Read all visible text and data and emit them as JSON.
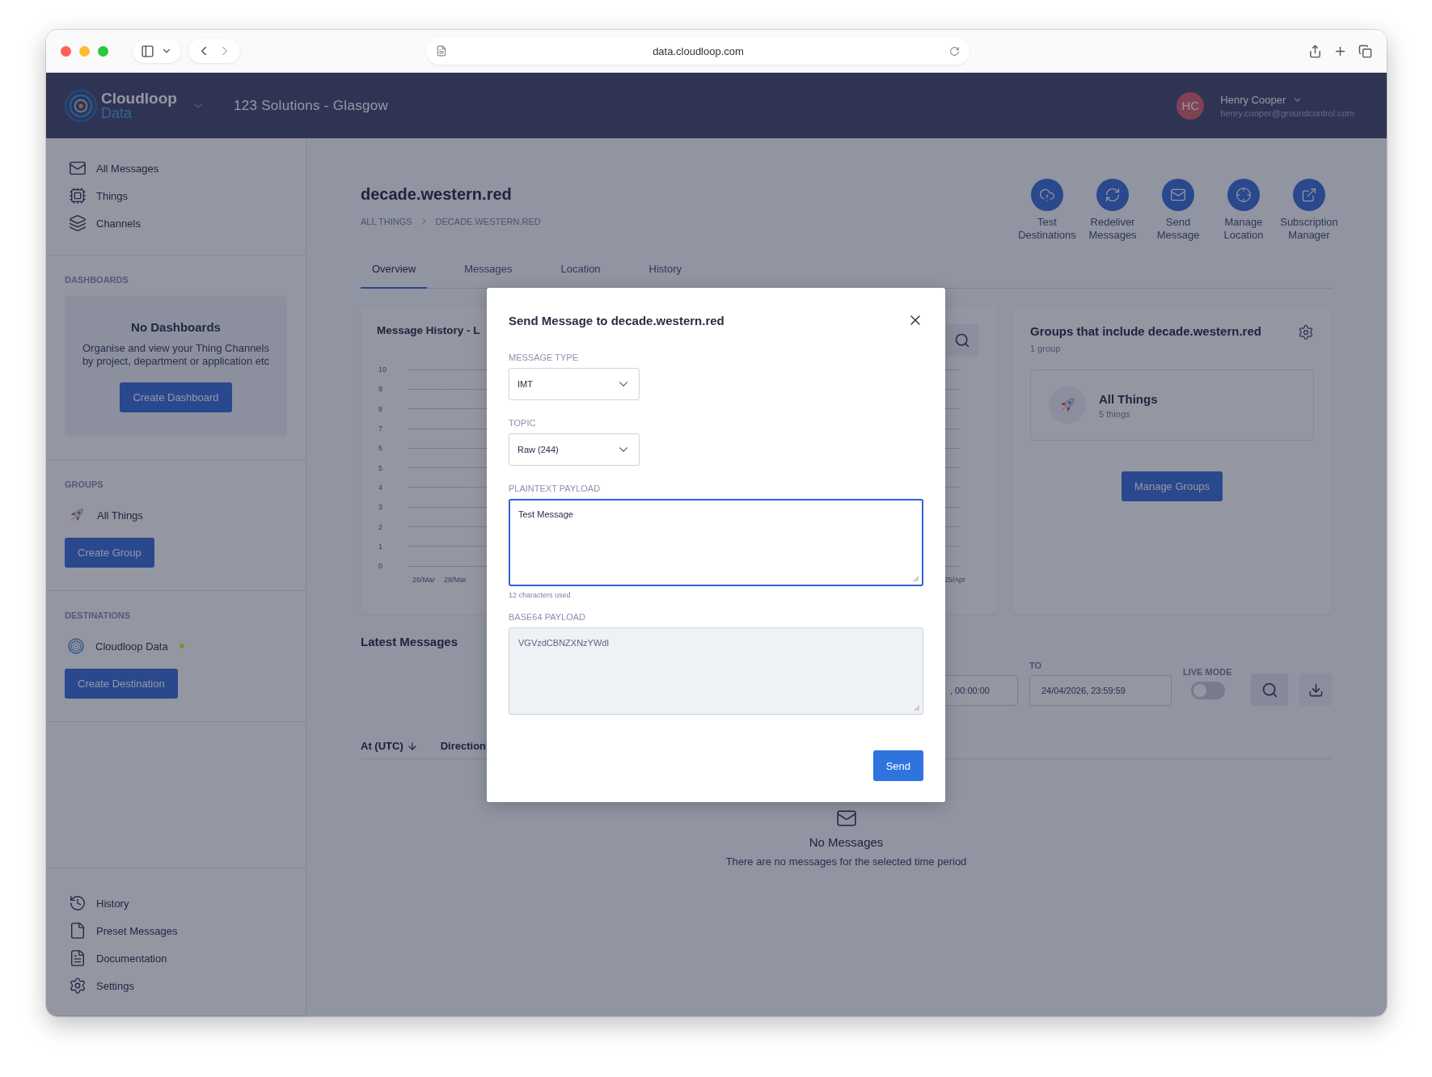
{
  "browser": {
    "url": "data.cloudloop.com"
  },
  "header": {
    "logo_line1": "Cloudloop",
    "logo_line2": "Data",
    "organisation": "123 Solutions - Glasgow",
    "user": {
      "initials": "HC",
      "name": "Henry Cooper",
      "email": "henry.cooper@groundcontrol.com"
    }
  },
  "sidebar": {
    "nav": [
      {
        "label": "All Messages"
      },
      {
        "label": "Things"
      },
      {
        "label": "Channels"
      }
    ],
    "dashboards": {
      "heading": "DASHBOARDS",
      "empty_title": "No Dashboards",
      "empty_text": "Organise and view your Thing Channels by project, department or application etc",
      "button": "Create Dashboard"
    },
    "groups": {
      "heading": "GROUPS",
      "items": [
        {
          "label": "All Things"
        }
      ],
      "button": "Create Group"
    },
    "destinations": {
      "heading": "DESTINATIONS",
      "items": [
        {
          "label": "Cloudloop Data",
          "color": "#6a9a3a"
        }
      ],
      "button": "Create Destination"
    },
    "footer": [
      {
        "label": "History"
      },
      {
        "label": "Preset Messages"
      },
      {
        "label": "Documentation"
      },
      {
        "label": "Settings"
      }
    ]
  },
  "thing": {
    "title": "decade.western.red",
    "breadcrumb": [
      "ALL THINGS",
      "DECADE.WESTERN.RED"
    ],
    "actions": [
      {
        "label": "Test Destinations"
      },
      {
        "label": "Redeliver Messages"
      },
      {
        "label": "Send Message"
      },
      {
        "label": "Manage Location"
      },
      {
        "label": "Subscription Manager"
      }
    ]
  },
  "tabs": [
    {
      "label": "Overview",
      "selected": true
    },
    {
      "label": "Messages",
      "selected": false
    },
    {
      "label": "Location",
      "selected": false
    },
    {
      "label": "History",
      "selected": false
    }
  ],
  "history_card": {
    "title": "Message History - L",
    "y_ticks": [
      "10",
      "9",
      "8",
      "7",
      "6",
      "5",
      "4",
      "3",
      "2",
      "1",
      "0"
    ],
    "x_ticks": [
      "26/Mar",
      "28/Mar",
      "25/Apr"
    ]
  },
  "groups_card": {
    "title": "Groups that include  decade.western.red",
    "count": "1 group",
    "group": {
      "name": "All Things",
      "count": "5 things"
    },
    "button": "Manage Groups"
  },
  "latest": {
    "title": "Latest Messages",
    "from_value": ", 00:00:00",
    "to_label": "TO",
    "to_value": "24/04/2026, 23:59:59",
    "live_label": "LIVE MODE",
    "live_on": false,
    "columns": [
      {
        "label": "At (UTC)",
        "sorted": true
      },
      {
        "label": "Direction",
        "sorted": false
      }
    ],
    "empty_title": "No Messages",
    "empty_text": "There are no messages for the selected time period"
  },
  "modal": {
    "title": "Send Message to decade.western.red",
    "button": "Send",
    "fields": [
      {
        "kind": "select",
        "label": "MESSAGE TYPE",
        "value": "IMT"
      },
      {
        "kind": "select",
        "label": "TOPIC",
        "value": "Raw (244)"
      },
      {
        "kind": "textarea",
        "label": "PLAINTEXT PAYLOAD",
        "value": "Test Message",
        "focused": true,
        "readonly": false,
        "hint": "12 characters used"
      },
      {
        "kind": "textarea",
        "label": "BASE64 PAYLOAD",
        "value": "VGVzdCBNZXNzYWdl",
        "focused": false,
        "readonly": true
      }
    ]
  }
}
